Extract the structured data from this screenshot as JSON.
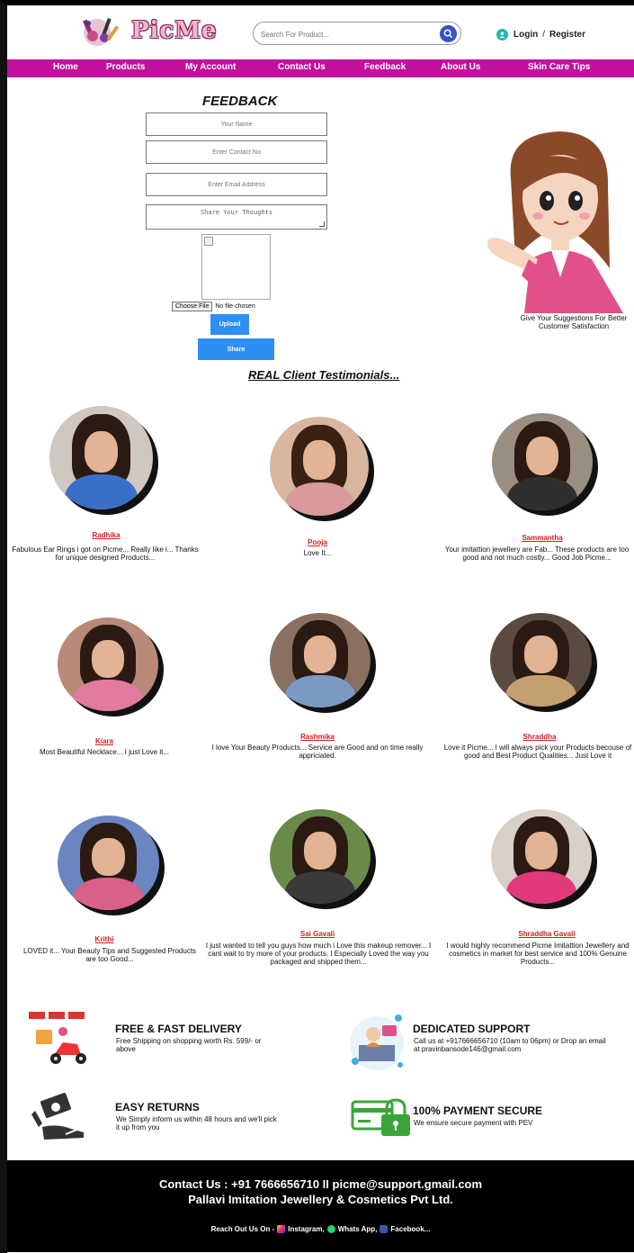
{
  "header": {
    "logo_text": "PicMe",
    "search_placeholder": "Search For Product...",
    "login_label": "Login",
    "separator": "/",
    "register_label": "Register"
  },
  "nav": {
    "items": [
      {
        "label": "Home"
      },
      {
        "label": "Products"
      },
      {
        "label": "My Account"
      },
      {
        "label": "Contact Us"
      },
      {
        "label": "Feedback"
      },
      {
        "label": "About Us"
      },
      {
        "label": "Skin Care Tips"
      }
    ]
  },
  "feedback": {
    "title": "FEEDBACK",
    "name_placeholder": "Your Name",
    "contact_placeholder": "Enter Contact No",
    "email_placeholder": "Enter Email Address",
    "thoughts_placeholder": "Share Your Thoughts",
    "choose_file_label": "Choose File",
    "no_file_label": "No file chosen",
    "upload_label": "Upload",
    "share_label": "Share",
    "mascot_caption": "Give Your Suggestions For Better Customer Satisfaction"
  },
  "testimonials": {
    "title": "REAL Client Testimonials...",
    "items": [
      {
        "name": "Radhika",
        "text": "Fabulous Ear Rings i got on Picme... Really like i... Thanks for unique designed Products..."
      },
      {
        "name": "Pooja",
        "text": "Love It..."
      },
      {
        "name": "Sammantha",
        "text": "Your imitattion jewellery are Fab... These products are too good and not much costly... Good Job Picme..."
      },
      {
        "name": "Kiara",
        "text": "Most Beautiful Necklace... I just Love it..."
      },
      {
        "name": "Rashmika",
        "text": "I love Your Beauty Products... Service are Good and on time really appriciated."
      },
      {
        "name": "Shraddha",
        "text": "Love it Picme... I will always pick your Products becouse of good and Best Product Qualities... Just Love it"
      },
      {
        "name": "Krithi",
        "text": "LOVED it... Your Beauty Tips and Suggested Products are too Good..."
      },
      {
        "name": "Sai Gavali",
        "text": "I just wanted to tell you guys how much i Love this makeup remover... I cant wait to try more of your products. I Especially Loved the way you packaged and shipped them..."
      },
      {
        "name": "Shraddha Gavali",
        "text": "I would highly recommend Picme Imitattion Jewellery and cosmetics in market for best service and 100% Genuine Products..."
      }
    ]
  },
  "features": {
    "delivery": {
      "title": "FREE & FAST DELIVERY",
      "text": "Free Shipping on shopping worth  Rs. 599/- or above"
    },
    "support": {
      "title": "DEDICATED SUPPORT",
      "text": "Call us at +917666656710 (10am to 06pm) or Drop an email at pravinbansode146@gmail.com"
    },
    "returns": {
      "title": "EASY RETURNS",
      "text": "We Simply inform us within 48 hours and we'll pick it up from you"
    },
    "payment": {
      "title": "100% PAYMENT SECURE",
      "text": "We ensure secure payment with PEV"
    }
  },
  "footer": {
    "contact_line": "Contact Us : +91 7666656710 II picme@support.gmail.com",
    "company_line": "Pallavi Imitation Jewellery & Cosmetics Pvt Ltd.",
    "reach_label": "Reach Out Us On -",
    "instagram_label": "Instagram,",
    "whatsapp_label": "Whats App,",
    "facebook_label": "Facebook..."
  },
  "colors": {
    "nav_bg": "#c2119f",
    "button_blue": "#2e8ff2",
    "name_red": "#d42020",
    "footer_bg": "#000000"
  }
}
